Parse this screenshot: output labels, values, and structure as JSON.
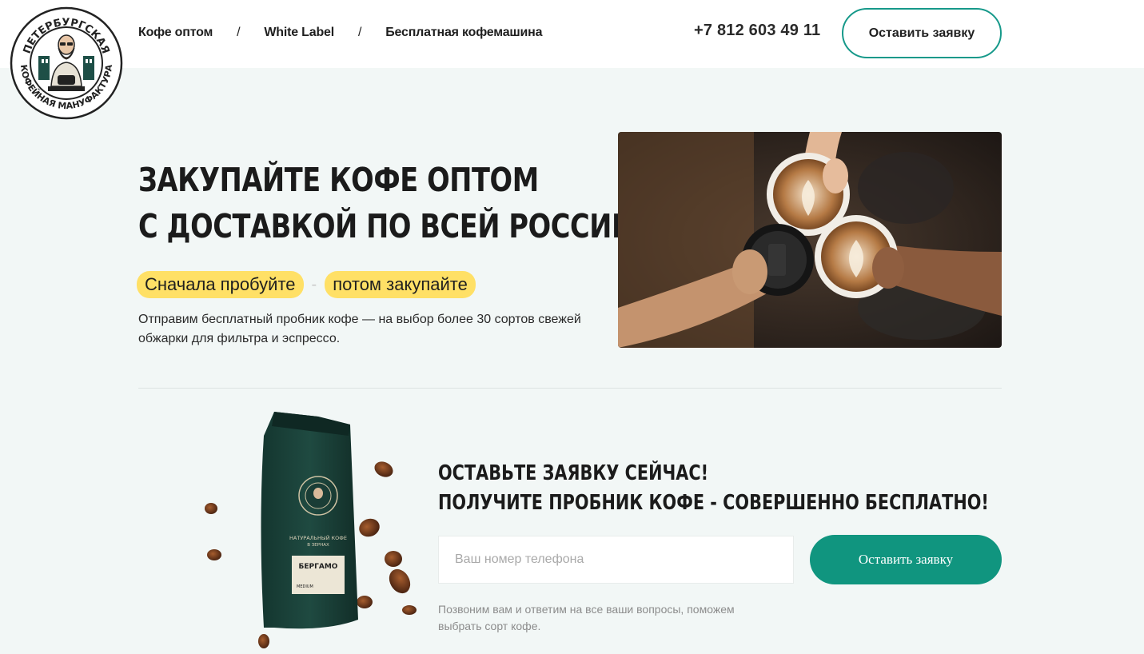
{
  "logo": {
    "top_text": "ПЕТЕРБУРГСКАЯ",
    "bottom_text": "КОФЕЙНАЯ МАНУФАКТУРА"
  },
  "nav": {
    "items": [
      {
        "label": "Кофе оптом"
      },
      {
        "label": "White Label"
      },
      {
        "label": "Бесплатная кофемашина"
      }
    ],
    "separator": "/"
  },
  "header": {
    "phone": "+7 812 603 49 11",
    "cta_label": "Оставить заявку"
  },
  "hero": {
    "title_line1": "ЗАКУПАЙТЕ КОФЕ ОПТОМ",
    "title_line2": "С ДОСТАВКОЙ ПО ВСЕЙ РОССИИ",
    "tag1": "Сначала пробуйте",
    "tag_dash": "-",
    "tag2": "потом закупайте",
    "description": "Отправим бесплатный пробник кофе — на выбор более 30 сортов свежей обжарки для фильтра и эспрессо."
  },
  "product": {
    "bag_line1": "НАТУРАЛЬНЫЙ КОФЕ",
    "bag_line2": "В ЗЕРНАХ",
    "bag_name": "БЕРГАМО",
    "bag_roast": "MEDIUM"
  },
  "form": {
    "title_line1": "ОСТАВЬТЕ ЗАЯВКУ СЕЙЧАС!",
    "title_line2": "ПОЛУЧИТЕ ПРОБНИК КОФЕ - СОВЕРШЕННО БЕСПЛАТНО!",
    "phone_placeholder": "Ваш номер телефона",
    "submit_label": "Оставить заявку",
    "note": "Позвоним вам и ответим на все ваши вопросы, поможем выбрать сорт кофе."
  },
  "colors": {
    "accent": "#10957f",
    "highlight": "#ffe066",
    "background": "#f2f7f6"
  }
}
